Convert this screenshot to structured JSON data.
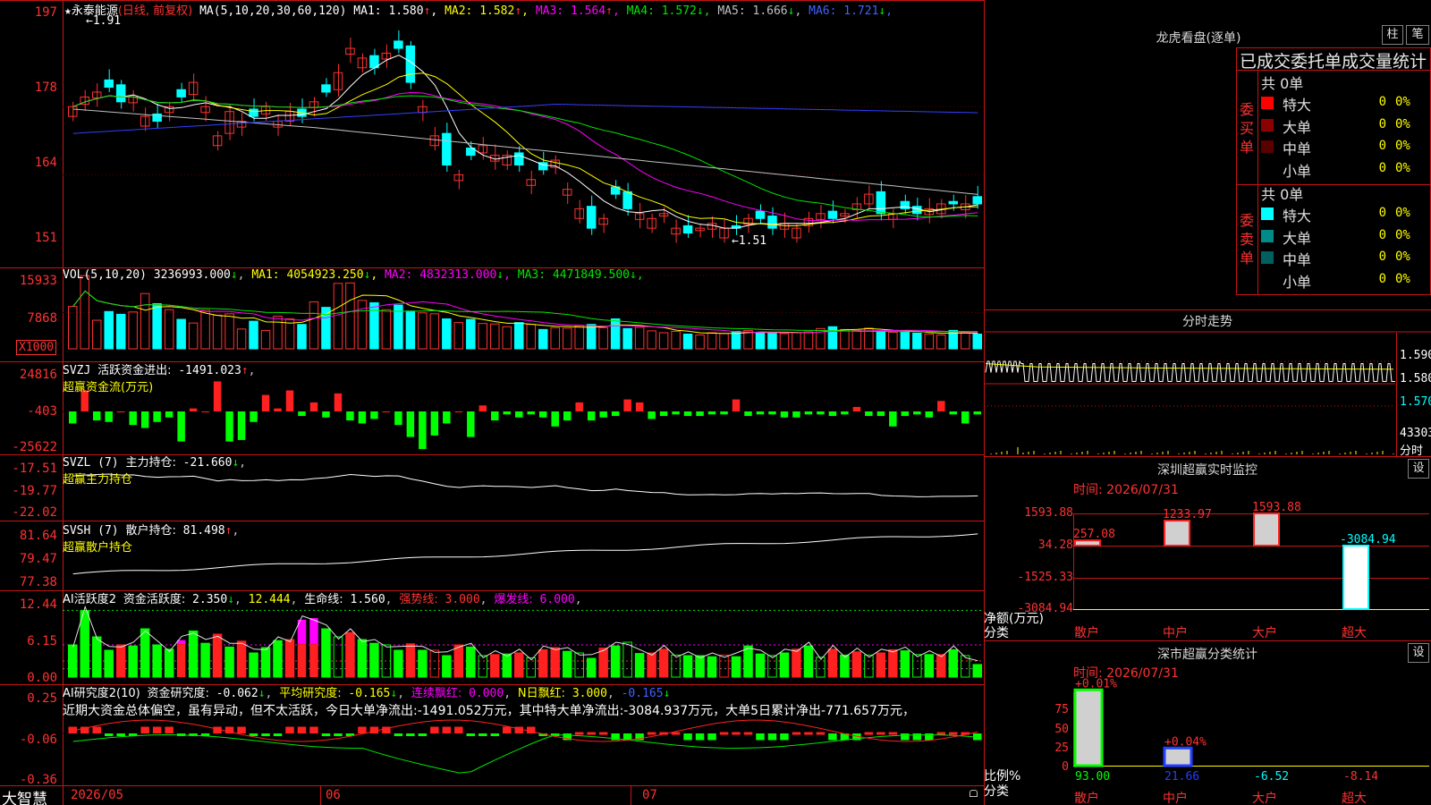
{
  "app": {
    "brand": "大智慧",
    "star": "★"
  },
  "price_panel": {
    "stock_name": "永泰能源",
    "period_label": "(日线, 前复权)",
    "ma_label": "MA(5,10,20,30,60,120)",
    "ma": [
      {
        "label": "MA1:",
        "value": "1.580",
        "arrow": "↑",
        "color": "#ffffff"
      },
      {
        "label": "MA2:",
        "value": "1.582",
        "arrow": "↑",
        "color": "#ffff00"
      },
      {
        "label": "MA3:",
        "value": "1.564",
        "arrow": "↑",
        "color": "#ff00ff"
      },
      {
        "label": "MA4:",
        "value": "1.572",
        "arrow": "↓",
        "color": "#00e600"
      },
      {
        "label": "MA5:",
        "value": "1.666",
        "arrow": "↓",
        "color": "#c0c0c0"
      },
      {
        "label": "MA6:",
        "value": "1.721",
        "arrow": "↓",
        "color": "#4060ff"
      }
    ],
    "y_ticks": [
      "197",
      "178",
      "164",
      "151"
    ],
    "high_mark": "1.91",
    "low_mark": "1.51"
  },
  "vol_panel": {
    "title": "VOL(5,10,20)",
    "value": "3236993.000",
    "arrow": "↓",
    "ma": [
      {
        "label": "MA1:",
        "value": "4054923.250",
        "arrow": "↓",
        "color": "#ffff00"
      },
      {
        "label": "MA2:",
        "value": "4832313.000",
        "arrow": "↓",
        "color": "#ff00ff"
      },
      {
        "label": "MA3:",
        "value": "4471849.500",
        "arrow": "↓",
        "color": "#00e600"
      }
    ],
    "y_ticks": [
      "15933",
      "7868"
    ],
    "unit": "X1000"
  },
  "svzj_panel": {
    "title": "SVZJ",
    "label": "活跃资金进出:",
    "value": "-1491.023",
    "arrow": "↑",
    "subtitle": "超赢资金流(万元)",
    "y_ticks": [
      "24816",
      "-403",
      "-25622"
    ]
  },
  "svzl_panel": {
    "title": "SVZL (7)",
    "label": "主力持仓:",
    "value": "-21.660",
    "arrow": "↓",
    "subtitle": "超赢主力持仓",
    "y_ticks": [
      "-17.51",
      "-19.77",
      "-22.02"
    ]
  },
  "svsh_panel": {
    "title": "SVSH (7)",
    "label": "散户持仓:",
    "value": "81.498",
    "arrow": "↑",
    "subtitle": "超赢散户持仓",
    "y_ticks": [
      "81.64",
      "79.47",
      "77.38"
    ]
  },
  "ai_active_panel": {
    "title": "AI活跃度2",
    "label1": "资金活跃度:",
    "value1": "2.350",
    "arrow1": "↓",
    "value2": "12.444",
    "label3": "生命线:",
    "value3": "1.560",
    "label4": "强势线:",
    "value4": "3.000",
    "label5": "爆发线:",
    "value5": "6.000",
    "y_ticks": [
      "12.44",
      "6.15",
      "0.00"
    ]
  },
  "ai_research_panel": {
    "title": "AI研究度2(10)",
    "label1": "资金研究度:",
    "value1": "-0.062",
    "arrow1": "↓",
    "label2": "平均研究度:",
    "value2": "-0.165",
    "arrow2": "↓",
    "label3": "连续飘红:",
    "value3": "0.000",
    "label4": "N日飘红:",
    "value4": "3.000",
    "value5": "-0.165",
    "arrow5": "↓",
    "commentary": "近期大资金总体偏空，虽有异动，但不太活跃，今日大单净流出:-1491.052万元，其中特大单净流出:-3084.937万元，大单5日累计净出-771.657万元，",
    "y_ticks": [
      "0.25",
      "-0.06",
      "-0.36"
    ]
  },
  "x_axis": {
    "labels": [
      "2026/05",
      "06",
      "07"
    ]
  },
  "dragon_tiger": {
    "title": "龙虎看盘(逐单)",
    "btn_bar": "柱",
    "btn_pie": "笔",
    "header": "已成交委托单成交量统计",
    "buy": {
      "side_label": "委买单",
      "total": "共 0单",
      "rows": [
        {
          "label": "特大",
          "count": "0",
          "pct": "0%",
          "color": "#ff0000"
        },
        {
          "label": "大单",
          "count": "0",
          "pct": "0%",
          "color": "#8b0000"
        },
        {
          "label": "中单",
          "count": "0",
          "pct": "0%",
          "color": "#5a0000"
        },
        {
          "label": "小单",
          "count": "0",
          "pct": "0%",
          "color": "#000000"
        }
      ]
    },
    "sell": {
      "side_label": "委卖单",
      "total": "共 0单",
      "rows": [
        {
          "label": "特大",
          "count": "0",
          "pct": "0%",
          "color": "#00ffff"
        },
        {
          "label": "大单",
          "count": "0",
          "pct": "0%",
          "color": "#008b8b"
        },
        {
          "label": "中单",
          "count": "0",
          "pct": "0%",
          "color": "#006060"
        },
        {
          "label": "小单",
          "count": "0",
          "pct": "0%",
          "color": "#000000"
        }
      ]
    }
  },
  "intraday": {
    "title": "分时走势",
    "y_ticks": [
      "1.590",
      "1.580",
      "1.570"
    ],
    "vol_max": "43303",
    "vol_label": "分时"
  },
  "sz_monitor": {
    "title": "深圳超赢实时监控",
    "btn": "设",
    "date_label": "时间:",
    "date": "2026/07/31",
    "y_ticks": [
      "1593.88",
      "34.28",
      "-1525.33",
      "-3084.94"
    ],
    "unit_label": "净额(万元)",
    "cat_label": "分类",
    "chart_data": {
      "type": "bar",
      "categories": [
        "散户",
        "中户",
        "大户",
        "超大"
      ],
      "values": [
        257.08,
        1233.97,
        1593.88,
        -3084.94
      ],
      "ylim": [
        -3084.94,
        1593.88
      ]
    }
  },
  "sz_class": {
    "title": "深市超赢分类统计",
    "btn": "设",
    "date_label": "时间:",
    "date": "2026/07/31",
    "y_ticks": [
      "75",
      "50",
      "25",
      "0"
    ],
    "pct_label": "比例%",
    "cat_label": "分类",
    "chart_data": {
      "type": "bar",
      "categories": [
        "散户",
        "中户",
        "大户",
        "超大"
      ],
      "values": [
        93.0,
        21.66,
        -6.52,
        -8.14
      ],
      "top_labels": [
        "+0.01%",
        "+0.04%",
        "",
        ""
      ],
      "ylim": [
        0,
        90
      ]
    }
  },
  "colors": {
    "up": "#ff3232",
    "down": "#00ffff",
    "ma1": "#ffffff",
    "ma2": "#ffff00",
    "ma3": "#ff00ff",
    "ma4": "#00e600",
    "ma5": "#c0c0c0",
    "ma6": "#3040ff",
    "grid": "#ff2020"
  }
}
